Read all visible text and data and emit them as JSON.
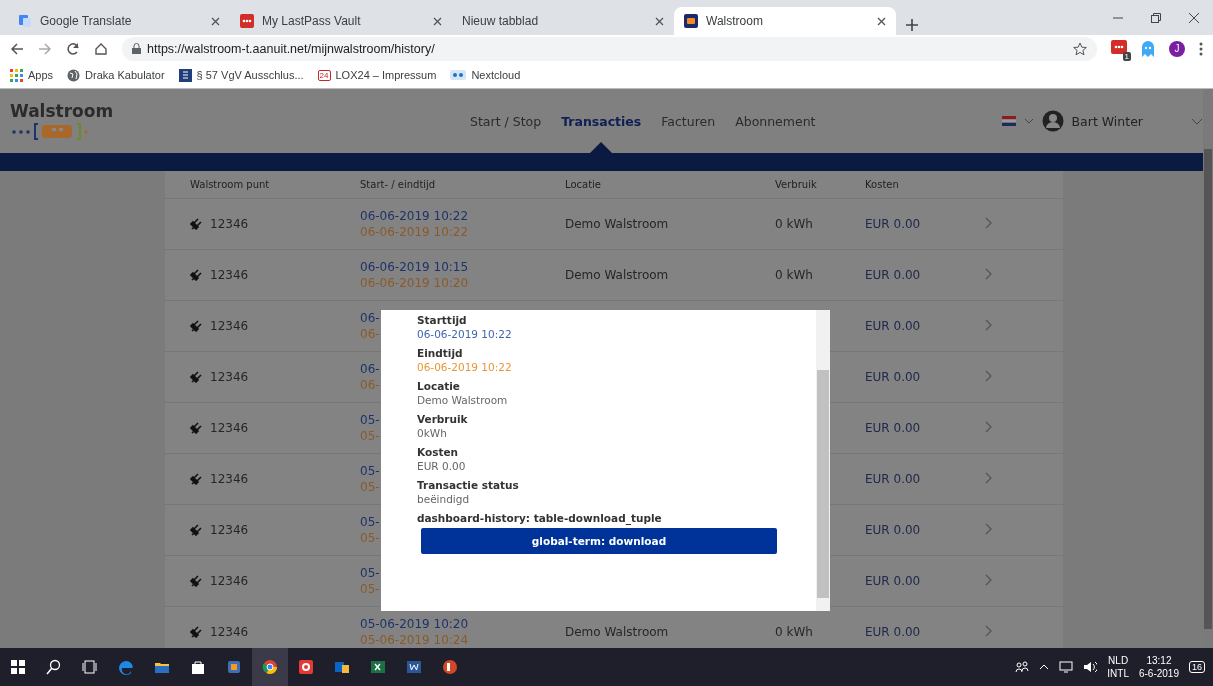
{
  "browser": {
    "tabs": [
      {
        "title": "Google Translate",
        "selected": false
      },
      {
        "title": "My LastPass Vault",
        "selected": false
      },
      {
        "title": "Nieuw tabblad",
        "selected": false
      },
      {
        "title": "Walstroom",
        "selected": true
      }
    ],
    "address": {
      "url": "https://walstroom-t.aanuit.net/mijnwalstroom/history/"
    },
    "extension_badge": "1",
    "profile_initial": "J",
    "bookmarks": [
      {
        "label": "Apps"
      },
      {
        "label": "Draka Kabulator"
      },
      {
        "label": "§ 57 VgV Ausschlus..."
      },
      {
        "label": "LOX24 – Impressum",
        "icon_text": "24"
      },
      {
        "label": "Nextcloud"
      }
    ]
  },
  "site": {
    "logo": "Walstroom",
    "nav": [
      {
        "label": "Start / Stop",
        "selected": false
      },
      {
        "label": "Transacties",
        "selected": true
      },
      {
        "label": "Facturen",
        "selected": false
      },
      {
        "label": "Abonnement",
        "selected": false
      }
    ],
    "user": "Bart Winter"
  },
  "table": {
    "columns": [
      "Walstroom punt",
      "Start- / eindtijd",
      "Locatie",
      "Verbruik",
      "Kosten"
    ],
    "rows": [
      {
        "point": "12346",
        "start": "06-06-2019 10:22",
        "end": "06-06-2019 10:22",
        "location": "Demo Walstroom",
        "usage": "0 kWh",
        "cost": "EUR 0.00"
      },
      {
        "point": "12346",
        "start": "06-06-2019 10:15",
        "end": "06-06-2019 10:20",
        "location": "Demo Walstroom",
        "usage": "0 kWh",
        "cost": "EUR 0.00"
      },
      {
        "point": "12346",
        "start": "06-",
        "end": "06-",
        "cost": "EUR 0.00"
      },
      {
        "point": "12346",
        "start": "06-",
        "end": "06-",
        "cost": "EUR 0.00"
      },
      {
        "point": "12346",
        "start": "05-",
        "end": "05-",
        "cost": "EUR 0.00"
      },
      {
        "point": "12346",
        "start": "05-",
        "end": "05-",
        "cost": "EUR 0.00"
      },
      {
        "point": "12346",
        "start": "05-",
        "end": "05-",
        "cost": "EUR 0.00"
      },
      {
        "point": "12346",
        "start": "05-",
        "end": "05-",
        "cost": "EUR 0.00"
      },
      {
        "point": "12346",
        "start": "05-06-2019 10:20",
        "end": "05-06-2019 10:24",
        "location": "Demo Walstroom",
        "usage": "0 kWh",
        "cost": "EUR 0.00"
      }
    ]
  },
  "modal": {
    "fields": [
      {
        "label": "Starttijd",
        "value": "06-06-2019 10:22",
        "kind": "start"
      },
      {
        "label": "Eindtijd",
        "value": "06-06-2019 10:22",
        "kind": "end"
      },
      {
        "label": "Locatie",
        "value": "Demo Walstroom",
        "kind": "plain"
      },
      {
        "label": "Verbruik",
        "value": "0kWh",
        "kind": "plain"
      },
      {
        "label": "Kosten",
        "value": "EUR 0.00",
        "kind": "plain"
      },
      {
        "label": "Transactie status",
        "value": "beëindigd",
        "kind": "plain"
      }
    ],
    "note": "dashboard-history: table-download_tuple",
    "button": "global-term: download"
  },
  "taskbar": {
    "language": "NLD",
    "layout": "INTL",
    "time": "13:12",
    "date": "6-6-2019",
    "notifications": "16"
  }
}
